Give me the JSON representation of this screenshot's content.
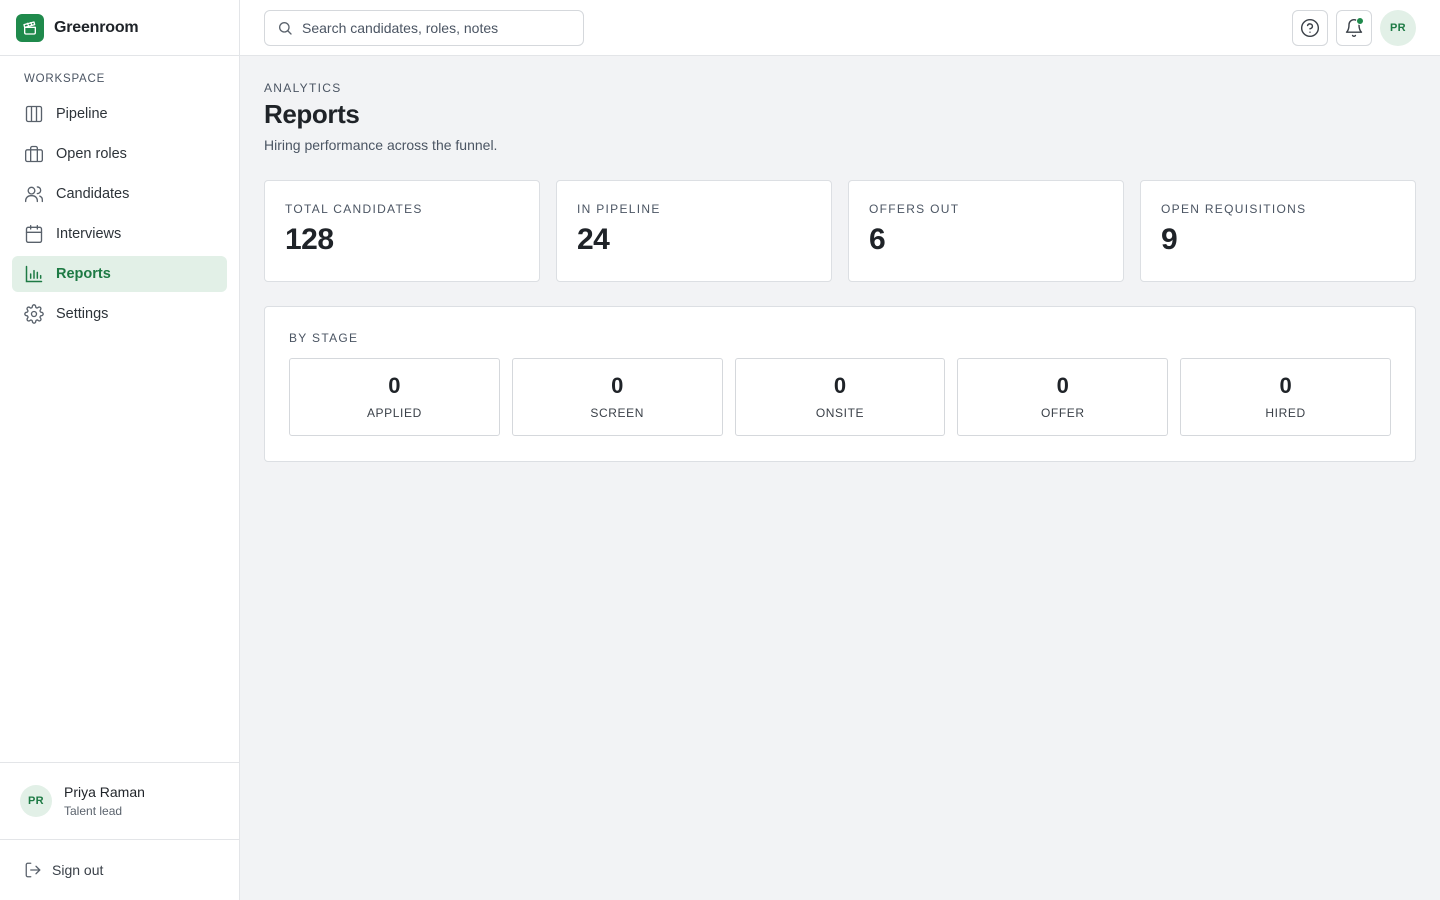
{
  "app": {
    "name": "Greenroom"
  },
  "sidebar": {
    "section_label": "WORKSPACE",
    "items": [
      {
        "label": "Pipeline",
        "icon": "columns-icon",
        "active": false
      },
      {
        "label": "Open roles",
        "icon": "briefcase-icon",
        "active": false
      },
      {
        "label": "Candidates",
        "icon": "users-icon",
        "active": false
      },
      {
        "label": "Interviews",
        "icon": "calendar-icon",
        "active": false
      },
      {
        "label": "Reports",
        "icon": "bar-chart-icon",
        "active": true
      },
      {
        "label": "Settings",
        "icon": "gear-icon",
        "active": false
      }
    ],
    "user": {
      "initials": "PR",
      "name": "Priya Raman",
      "role": "Talent lead"
    },
    "signout_label": "Sign out"
  },
  "topbar": {
    "search_placeholder": "Search candidates, roles, notes",
    "avatar_initials": "PR"
  },
  "page": {
    "eyebrow": "ANALYTICS",
    "title": "Reports",
    "subtitle": "Hiring performance across the funnel."
  },
  "stats": [
    {
      "label": "TOTAL CANDIDATES",
      "value": "128"
    },
    {
      "label": "IN PIPELINE",
      "value": "24"
    },
    {
      "label": "OFFERS OUT",
      "value": "6"
    },
    {
      "label": "OPEN REQUISITIONS",
      "value": "9"
    }
  ],
  "by_stage": {
    "heading": "BY STAGE",
    "stages": [
      {
        "name": "APPLIED",
        "count": "0"
      },
      {
        "name": "SCREEN",
        "count": "0"
      },
      {
        "name": "ONSITE",
        "count": "0"
      },
      {
        "name": "OFFER",
        "count": "0"
      },
      {
        "name": "HIRED",
        "count": "0"
      }
    ]
  },
  "colors": {
    "accent": "#1f8a4c",
    "active_bg": "#e2f0e7",
    "background": "#f2f3f5"
  }
}
